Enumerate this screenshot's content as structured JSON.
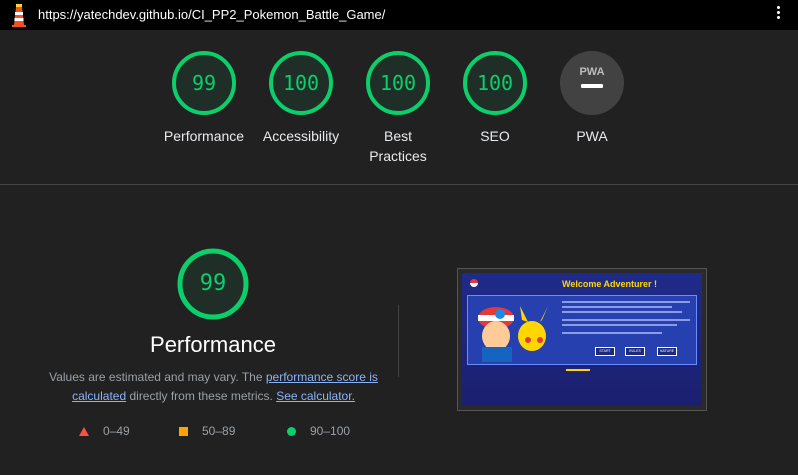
{
  "topbar": {
    "url": "https://yatechdev.github.io/CI_PP2_Pokemon_Battle_Game/"
  },
  "colors": {
    "pass": "#0cce6b",
    "average": "#ffa400",
    "fail": "#ff4e42",
    "pwa_gray": "#3c3c3c",
    "link": "#8ab4f8"
  },
  "categories": [
    {
      "score": "99",
      "label": "Performance",
      "fraction": 0.99
    },
    {
      "score": "100",
      "label": "Accessibility",
      "fraction": 1.0
    },
    {
      "score": "100",
      "label": "Best Practices",
      "fraction": 1.0
    },
    {
      "score": "100",
      "label": "SEO",
      "fraction": 1.0
    },
    {
      "label": "PWA",
      "badge": "PWA"
    }
  ],
  "performance": {
    "score": "99",
    "fraction": 0.99,
    "title": "Performance",
    "note_prefix": "Values are estimated and may vary. The ",
    "note_link1": "performance score is calculated",
    "note_middle": " directly from these metrics. ",
    "note_link2": "See calculator."
  },
  "legend": [
    {
      "shape": "triangle",
      "range": "0–49"
    },
    {
      "shape": "square",
      "range": "50–89"
    },
    {
      "shape": "circle",
      "range": "90–100"
    }
  ],
  "thumbnail": {
    "title": "Welcome Adventurer !",
    "buttons": [
      "START",
      "RULES",
      "NATURE"
    ]
  }
}
